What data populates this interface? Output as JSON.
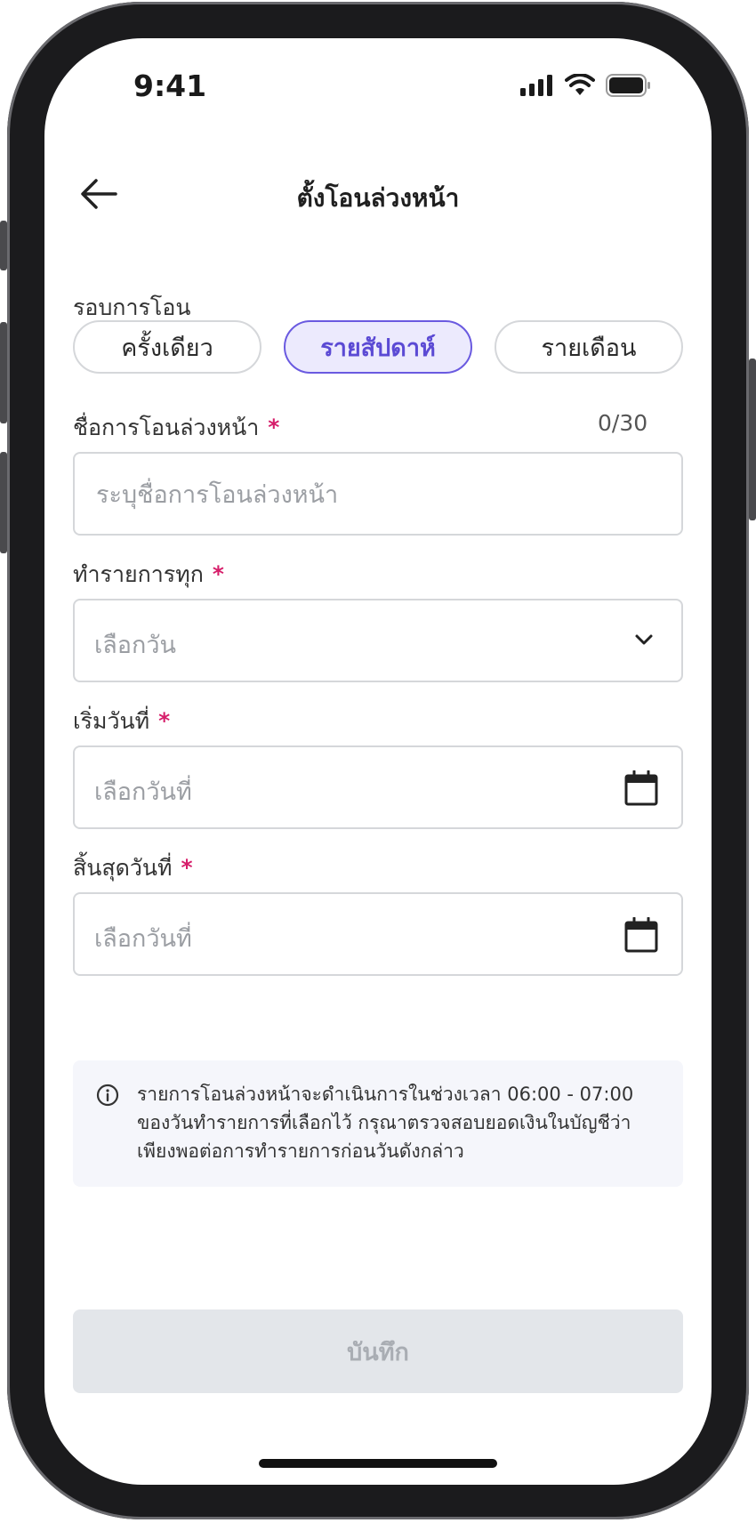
{
  "status_bar": {
    "time": "9:41"
  },
  "header": {
    "title": "ตั้งโอนล่วงหน้า"
  },
  "cycle": {
    "label": "รอบการโอน",
    "options": [
      "ครั้งเดียว",
      "รายสัปดาห์",
      "รายเดือน"
    ],
    "selected": "รายสัปดาห์"
  },
  "name_field": {
    "label": "ชื่อการโอนล่วงหน้า",
    "required_mark": "*",
    "counter": "0/30",
    "placeholder": "ระบุชื่อการโอนล่วงหน้า",
    "value": ""
  },
  "repeat_field": {
    "label": "ทำรายการทุก",
    "required_mark": "*",
    "placeholder": "เลือกวัน",
    "icon": "chevron-down-icon"
  },
  "start_field": {
    "label": "เริ่มวันที่",
    "required_mark": "*",
    "placeholder": "เลือกวันที่",
    "icon": "calendar-icon"
  },
  "end_field": {
    "label": "สิ้นสุดวันที่",
    "required_mark": "*",
    "placeholder": "เลือกวันที่",
    "icon": "calendar-icon"
  },
  "info": {
    "icon": "info-icon",
    "lines": [
      "รายการโอนล่วงหน้าจะดำเนินการในช่วงเวลา 06:00 - 07:00",
      "ของวันทำรายการที่เลือกไว้ กรุณาตรวจสอบยอดเงินในบัญชีว่า",
      "เพียงพอต่อการทำรายการก่อนวันดังกล่าว"
    ]
  },
  "save_button": {
    "label": "บันทึก",
    "enabled": false
  },
  "colors": {
    "accent": "#6a5ae0",
    "accent_bg": "#eceafd",
    "required": "#d61e6a",
    "disabled_bg": "#e3e6ea",
    "info_bg": "#f5f6fb"
  }
}
